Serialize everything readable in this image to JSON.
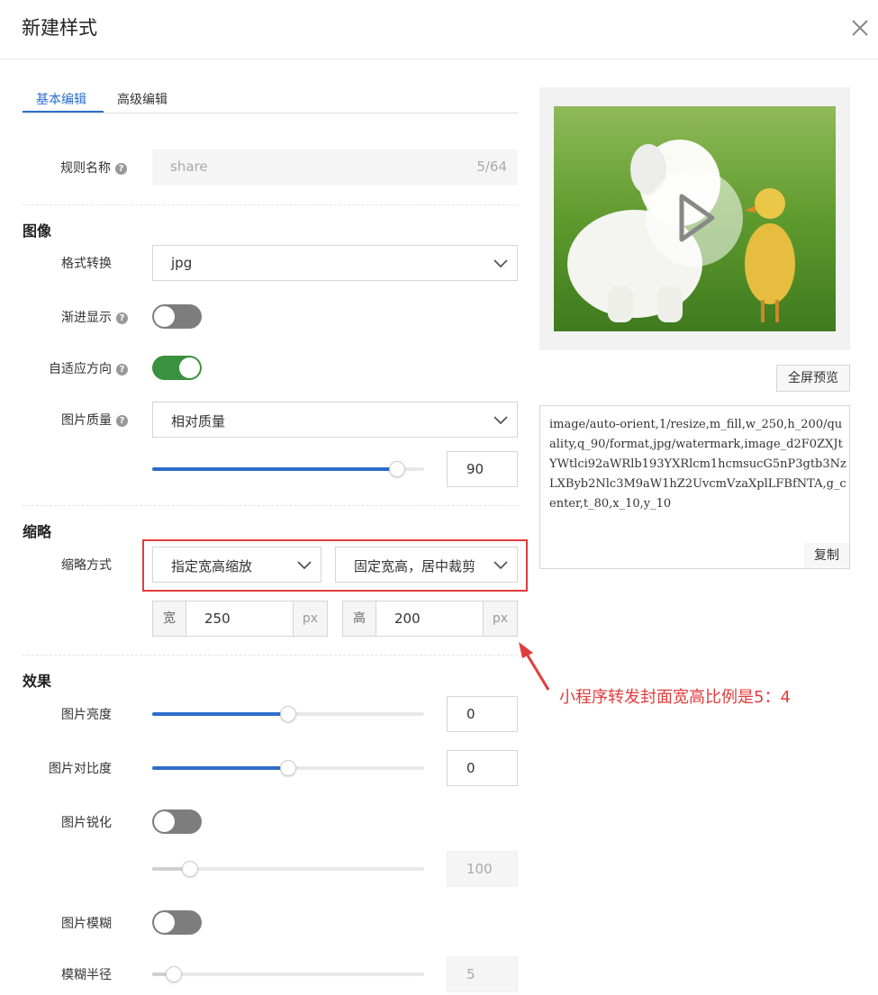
{
  "dialog": {
    "title": "新建样式"
  },
  "tabs": [
    "基本编辑",
    "高级编辑"
  ],
  "rule": {
    "label": "规则名称",
    "value": "share",
    "count": "5/64"
  },
  "image_section": {
    "title": "图像",
    "format": {
      "label": "格式转换",
      "value": "jpg"
    },
    "progressive": {
      "label": "渐进显示",
      "on": false
    },
    "auto_orient": {
      "label": "自适应方向",
      "on": true
    },
    "quality": {
      "label": "图片质量",
      "mode": "相对质量",
      "value": "90",
      "level": 0.9
    }
  },
  "thumbnail_section": {
    "title": "缩略",
    "mode_label": "缩略方式",
    "mode": "指定宽高缩放",
    "crop": "固定宽高，居中裁剪",
    "width_prefix": "宽",
    "width": "250",
    "height_prefix": "高",
    "height": "200",
    "unit": "px"
  },
  "annotation": "小程序转发封面宽高比例是5：4",
  "effects_section": {
    "title": "效果",
    "brightness": {
      "label": "图片亮度",
      "value": "0",
      "level": 0.5
    },
    "contrast": {
      "label": "图片对比度",
      "value": "0",
      "level": 0.5
    },
    "sharpen": {
      "label": "图片锐化",
      "on": false,
      "value": "100",
      "level": 0.14
    },
    "blur": {
      "label": "图片模糊",
      "on": false
    },
    "blur_radius": {
      "label": "模糊半径",
      "value": "5",
      "level": 0.08
    }
  },
  "preview": {
    "fullscreen_label": "全屏预览",
    "code": "image/auto-orient,1/resize,m_fill,w_250,h_200/quality,q_90/format,jpg/watermark,image_d2F0ZXJtYWtlci92aWRlb193YXRlcm1hcmsucG5nP3gtb3NzLXByb2Nlc3M9aW1hZ2UvcmVzaXplLFBfNTA,g_center,t_80,x_10,y_10",
    "copy_label": "复制"
  },
  "colors": {
    "accent": "#2d6ec9",
    "toggle_on": "#3a913f",
    "annotation": "#e23c3c"
  }
}
